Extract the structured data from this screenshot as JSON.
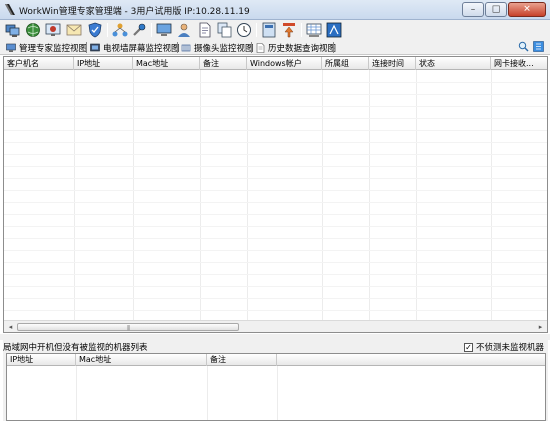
{
  "window": {
    "title": "WorkWin管理专家管理端 - 3用户试用版 IP:10.28.11.19",
    "minimize": "–",
    "maximize": "□",
    "close": "✕"
  },
  "toolbar": {
    "icons": [
      "computers-icon",
      "monitor-globe-icon",
      "screen-capture-icon",
      "mail-icon",
      "shield-icon",
      "network-icon",
      "tools-icon",
      "display-icon",
      "user-icon",
      "document-icon",
      "copy-icon",
      "clock-icon",
      "report-icon",
      "upload-icon",
      "grid-view-icon",
      "broadcast-icon"
    ]
  },
  "tabs": [
    {
      "label": "管理专家监控视图",
      "icon": "monitor-tab-icon"
    },
    {
      "label": "电视墙屏幕监控视图",
      "icon": "tv-wall-tab-icon"
    },
    {
      "label": "摄像头监控视图",
      "icon": "camera-tab-icon"
    },
    {
      "label": "历史数据查询视图",
      "icon": "history-tab-icon"
    }
  ],
  "main_table": {
    "columns": [
      "客户机名",
      "IP地址",
      "Mac地址",
      "备注",
      "Windows帐户",
      "所属组",
      "连接时间",
      "状态",
      "网卡接收..."
    ],
    "rows": []
  },
  "bottom_panel": {
    "title": "局域网中开机但没有被监视的机器列表",
    "checkbox_label": "不侦测未监视机器",
    "checkbox_checked": true,
    "columns": [
      "IP地址",
      "Mac地址",
      "备注"
    ],
    "rows": []
  },
  "scrollbar": {
    "left_arrow": "◂",
    "right_arrow": "▸",
    "grip": "|||"
  }
}
